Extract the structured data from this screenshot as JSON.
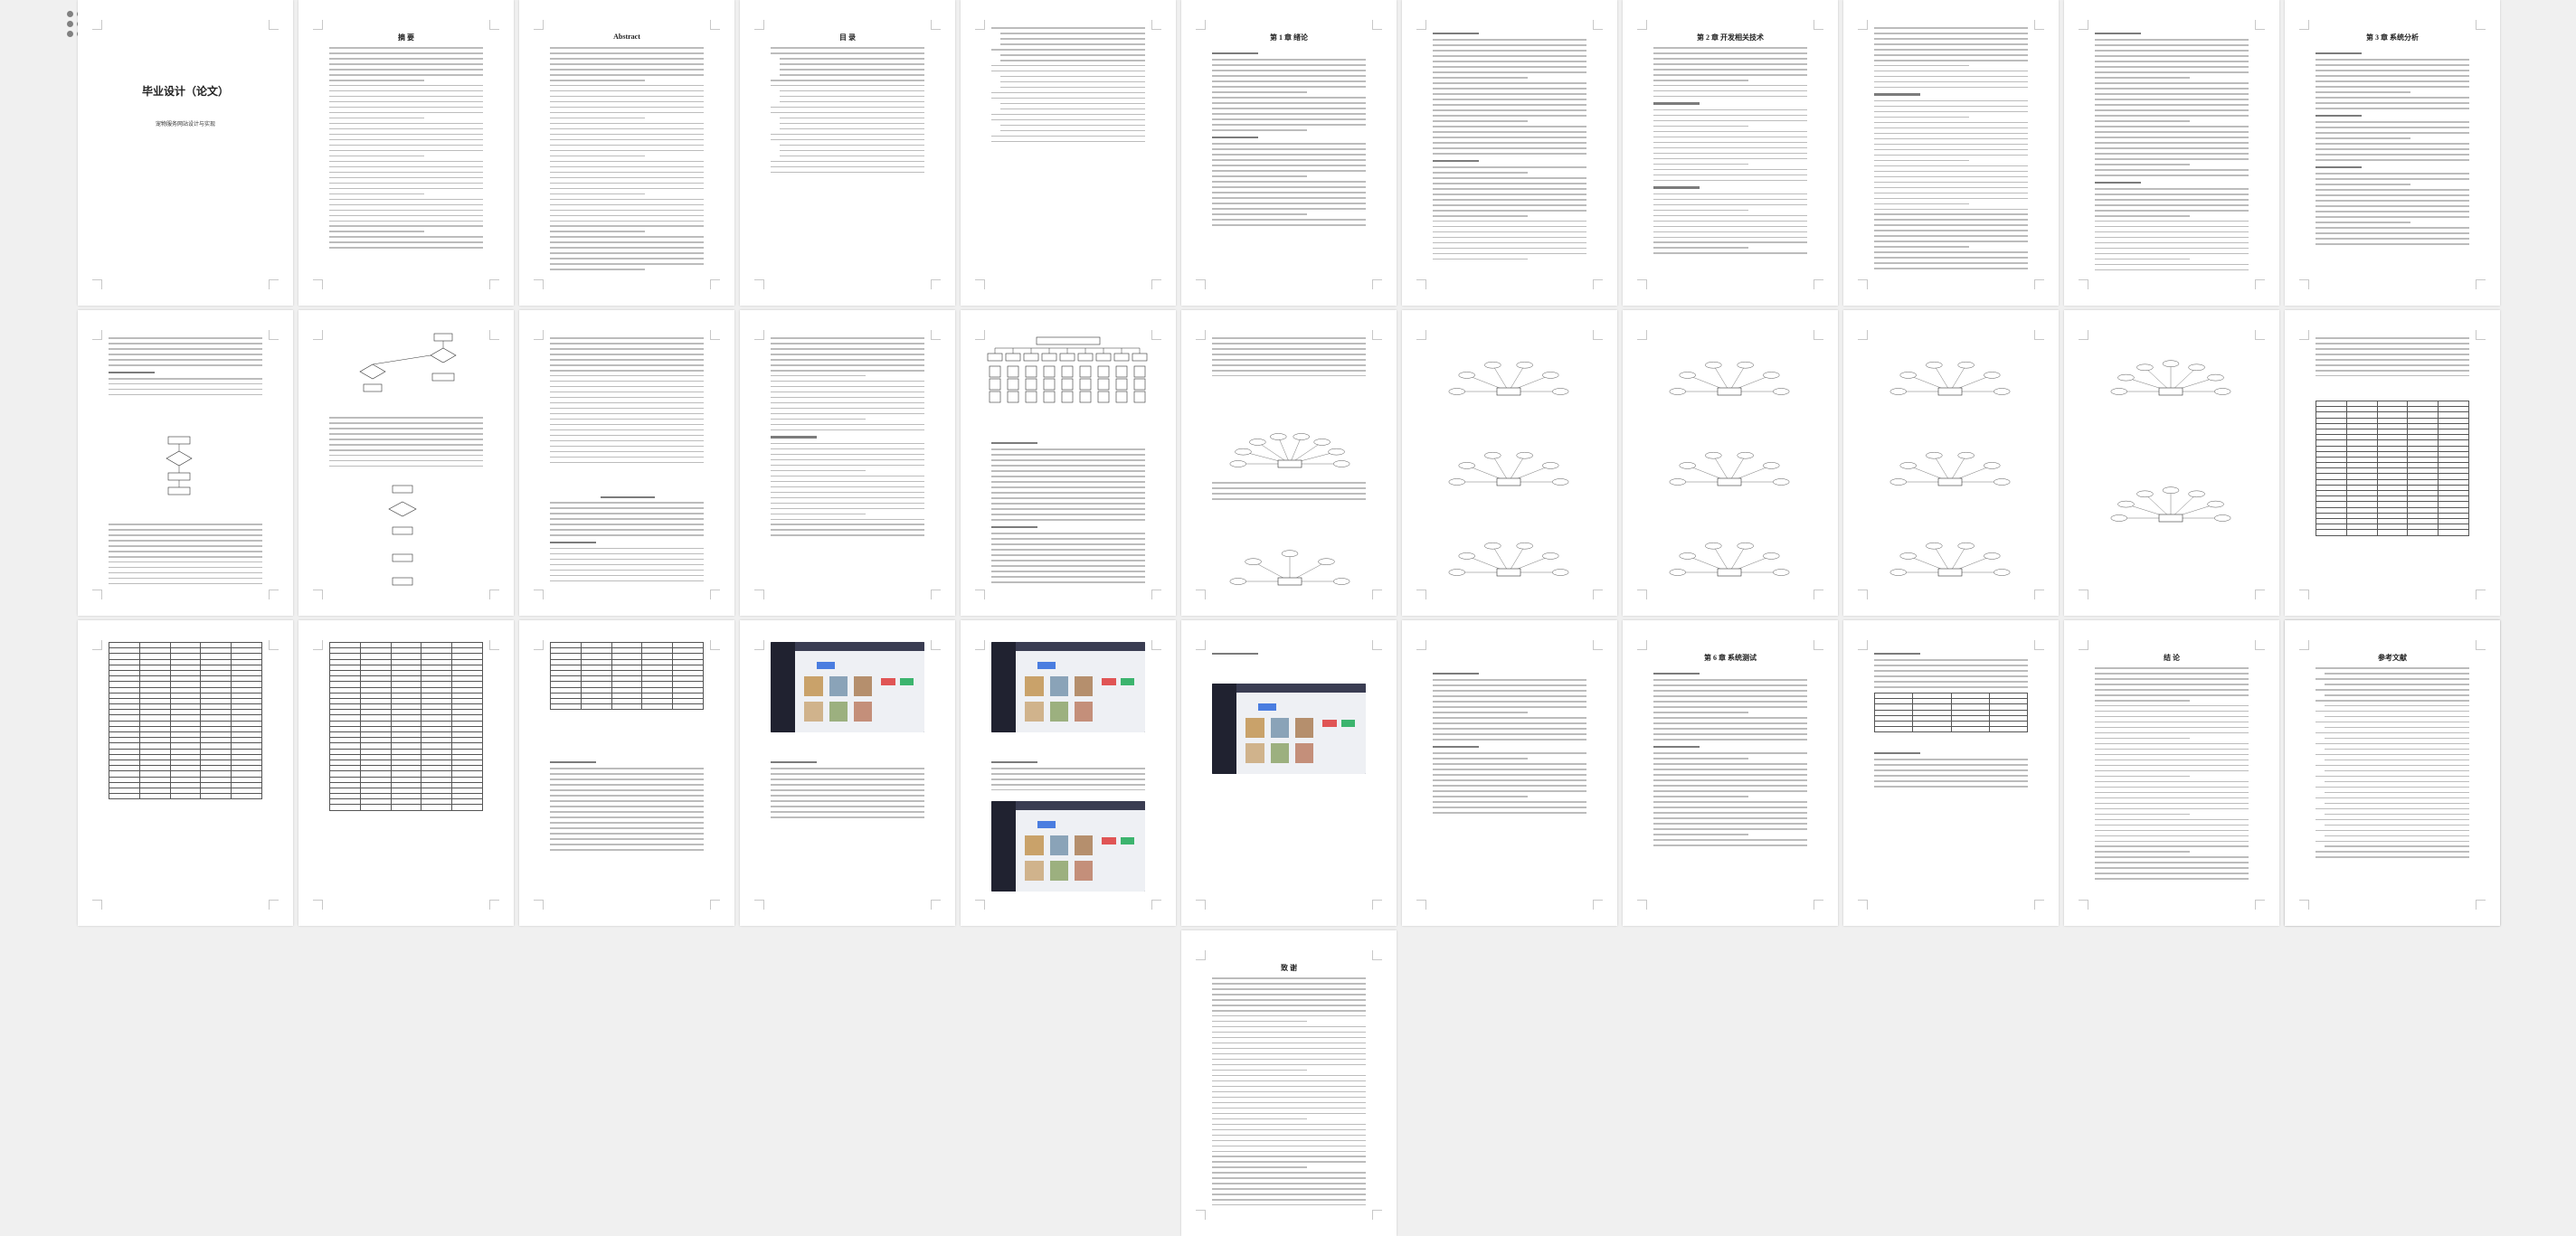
{
  "toolbar": {
    "grid_icon": "grid-view-icon"
  },
  "pages": [
    {
      "id": "cover",
      "title": "毕业设计（论文）",
      "subtitle": "宠物服务网站设计与实现"
    },
    {
      "id": "abstract-cn",
      "title": "摘 要"
    },
    {
      "id": "abstract-en",
      "title": "Abstract"
    },
    {
      "id": "toc",
      "title": "目 录"
    },
    {
      "id": "toc-2",
      "title": ""
    },
    {
      "id": "ch1",
      "title": "第 1 章 绪论"
    },
    {
      "id": "p7",
      "title": ""
    },
    {
      "id": "ch2",
      "title": "第 2 章 开发相关技术"
    },
    {
      "id": "p9",
      "title": ""
    },
    {
      "id": "p10",
      "title": ""
    },
    {
      "id": "ch3",
      "title": "第 3 章 系统分析"
    },
    {
      "id": "p12",
      "title": ""
    },
    {
      "id": "p13",
      "title": ""
    },
    {
      "id": "p14",
      "title": ""
    },
    {
      "id": "p15",
      "title": ""
    },
    {
      "id": "p16",
      "title": ""
    },
    {
      "id": "p17",
      "title": ""
    },
    {
      "id": "p18",
      "title": ""
    },
    {
      "id": "p19",
      "title": ""
    },
    {
      "id": "p20",
      "title": ""
    },
    {
      "id": "p21",
      "title": ""
    },
    {
      "id": "p22",
      "title": ""
    },
    {
      "id": "p23",
      "title": ""
    },
    {
      "id": "p24",
      "title": ""
    },
    {
      "id": "p25",
      "title": ""
    },
    {
      "id": "p26",
      "title": ""
    },
    {
      "id": "p27",
      "title": ""
    },
    {
      "id": "p28",
      "title": ""
    },
    {
      "id": "p29",
      "title": ""
    },
    {
      "id": "ch6",
      "title": "第 6 章 系统测试"
    },
    {
      "id": "p31",
      "title": ""
    },
    {
      "id": "conclusion",
      "title": "结 论"
    },
    {
      "id": "p33",
      "title": ""
    },
    {
      "id": "references",
      "title": "参考文献"
    },
    {
      "id": "thanks",
      "title": "致 谢"
    }
  ]
}
